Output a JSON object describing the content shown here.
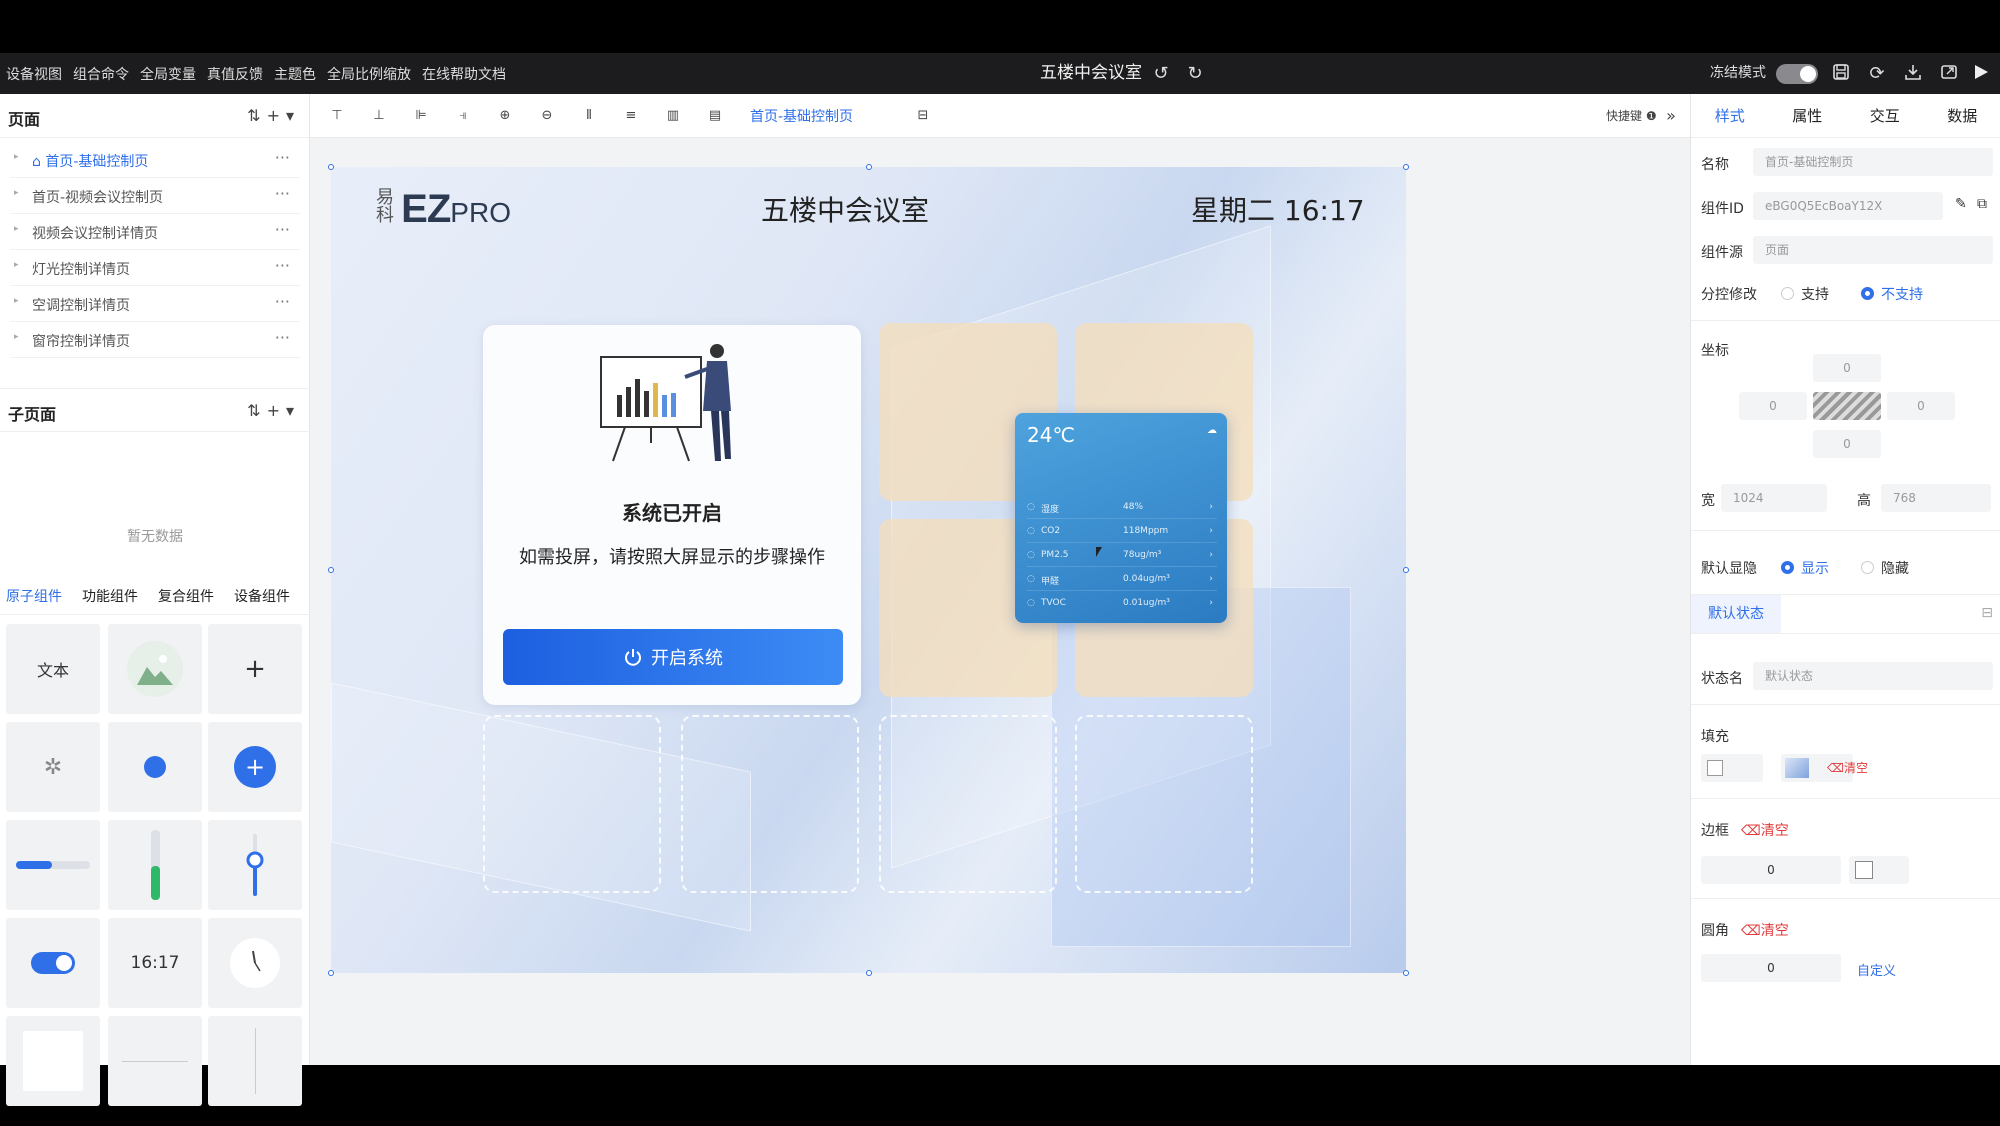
{
  "topbar": {
    "menu": [
      "设备视图",
      "组合命令",
      "全局变量",
      "真值反馈",
      "主题色",
      "全局比例缩放",
      "在线帮助文档"
    ],
    "title": "五楼中会议室",
    "freeze_label": "冻结模式"
  },
  "left": {
    "pages_title": "页面",
    "pages": [
      "首页-基础控制页",
      "首页-视频会议控制页",
      "视频会议控制详情页",
      "灯光控制详情页",
      "空调控制详情页",
      "窗帘控制详情页"
    ],
    "subpages_title": "子页面",
    "empty_text": "暂无数据",
    "comp_tabs": [
      "原子组件",
      "功能组件",
      "复合组件",
      "设备组件"
    ],
    "text_widget": "文本",
    "time_widget": "16:17"
  },
  "toolbar": {
    "current_page": "首页-基础控制页",
    "shortcut": "快捷键"
  },
  "canvas": {
    "logo_cn": "易科",
    "logo_ez": "EZ",
    "logo_pro": "PRO",
    "room_title": "五楼中会议室",
    "clock": "星期二 16:17",
    "sys_title": "系统已开启",
    "sys_sub": "如需投屏，请按照大屏显示的步骤操作",
    "start_btn": "开启系统",
    "weather": {
      "temp": "24℃",
      "rows": [
        {
          "name": "湿度",
          "value": "48%"
        },
        {
          "name": "CO2",
          "value": "118Mppm"
        },
        {
          "name": "PM2.5",
          "value": "78ug/m³"
        },
        {
          "name": "甲醛",
          "value": "0.04ug/m³"
        },
        {
          "name": "TVOC",
          "value": "0.01ug/m³"
        }
      ]
    }
  },
  "right": {
    "tabs": [
      "样式",
      "属性",
      "交互",
      "数据"
    ],
    "name_label": "名称",
    "name_value": "首页-基础控制页",
    "id_label": "组件ID",
    "id_value": "eBG0Q5EcBoaY12X",
    "source_label": "组件源",
    "source_value": "页面",
    "split_label": "分控修改",
    "support": "支持",
    "not_support": "不支持",
    "coord_label": "坐标",
    "coord_top": "0",
    "coord_left": "0",
    "coord_right": "0",
    "coord_bottom": "0",
    "width_label": "宽",
    "width_value": "1024",
    "height_label": "高",
    "height_value": "768",
    "visible_label": "默认显隐",
    "show": "显示",
    "hide": "隐藏",
    "default_state": "默认状态",
    "state_name_label": "状态名",
    "state_name_value": "默认状态",
    "fill_label": "填充",
    "clear_fill": "清空",
    "border_label": "边框",
    "clear_border": "清空",
    "border_value": "0",
    "radius_label": "圆角",
    "clear_radius": "清空",
    "radius_value": "0",
    "custom": "自定义"
  },
  "colors": {
    "accent": "#2f6fe8",
    "danger": "#e03b3b",
    "button": "#1d5fe0"
  }
}
